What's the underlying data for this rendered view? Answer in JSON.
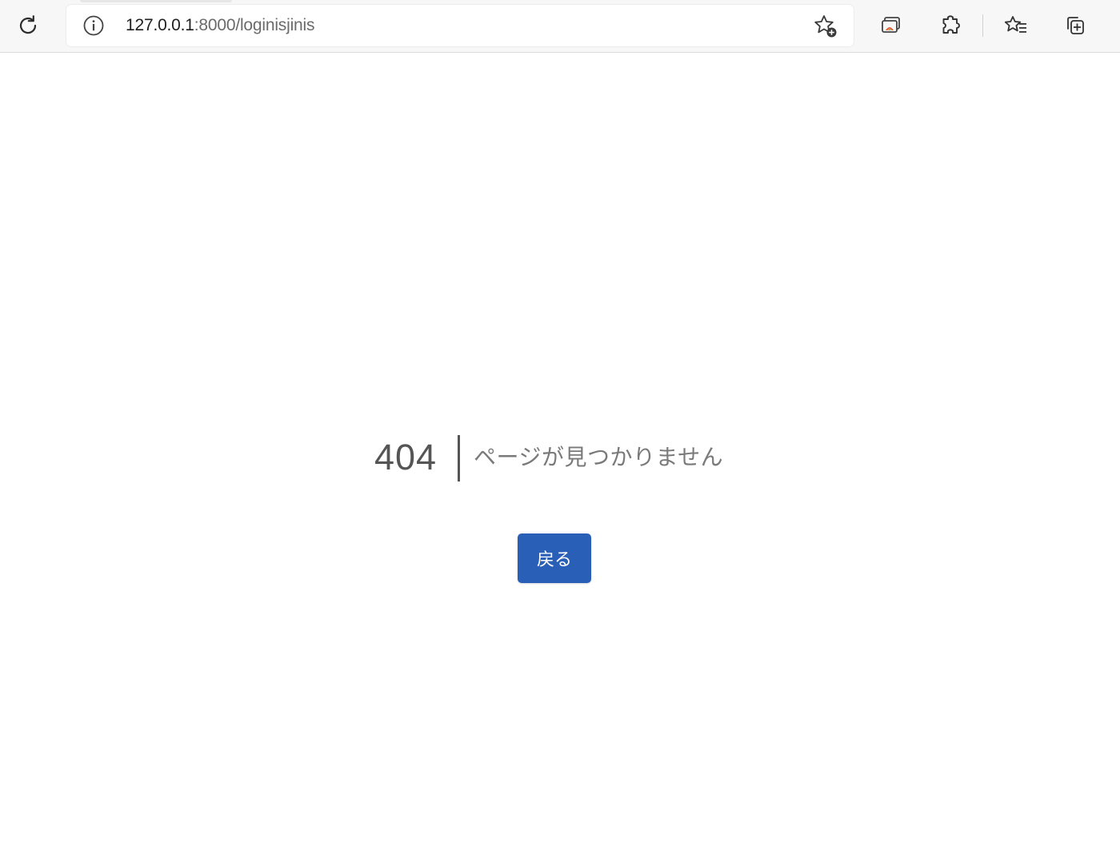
{
  "browser": {
    "address": {
      "host": "127.0.0.1",
      "path": ":8000/loginisjinis"
    },
    "icons": {
      "reload": "reload-icon",
      "info": "info-icon",
      "add_favorite": "star-add-icon",
      "app_available": "app-available-icon",
      "extensions": "puzzle-icon",
      "favorites": "favorites-list-icon",
      "collections": "collections-icon"
    }
  },
  "page": {
    "error_code": "404",
    "error_message": "ページが見つかりません",
    "back_label": "戻る"
  },
  "colors": {
    "accent": "#2a5fb8",
    "text_dark": "#555555",
    "text_muted": "#7a7a7a"
  }
}
